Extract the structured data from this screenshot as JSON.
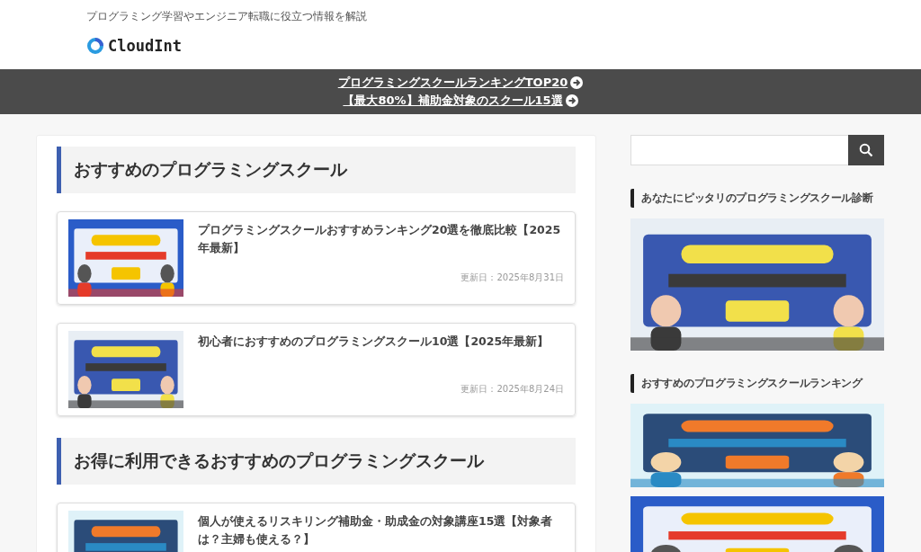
{
  "header": {
    "tagline": "プログラミング学習やエンジニア転職に役立つ情報を解説",
    "logo_text": "CloudInt"
  },
  "notice_bar": {
    "links": [
      {
        "text": "プログラミングスクールランキングTOP20"
      },
      {
        "text": "【最大80%】補助金対象のスクール15選"
      }
    ]
  },
  "main": {
    "sections": [
      {
        "heading": "おすすめのプログラミングスクール",
        "articles": [
          {
            "title": "プログラミングスクールおすすめランキング20選を徹底比較【2025年最新】",
            "date": "更新日：2025年8月31日"
          },
          {
            "title": "初心者におすすめのプログラミングスクール10選【2025年最新】",
            "date": "更新日：2025年8月24日"
          }
        ]
      },
      {
        "heading": "お得に利用できるおすすめのプログラミングスクール",
        "articles": [
          {
            "title": "個人が使えるリスキリング補助金・助成金の対象講座15選【対象者は？主婦も使える？】"
          }
        ]
      }
    ]
  },
  "sidebar": {
    "widgets": [
      {
        "heading": "あなたにピッタリのプログラミングスクール診断"
      },
      {
        "heading": "おすすめのプログラミングスクールランキング"
      }
    ]
  }
}
